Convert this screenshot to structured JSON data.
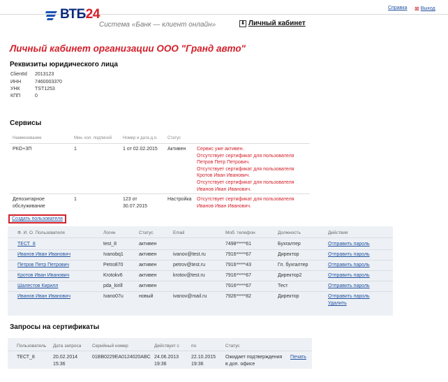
{
  "header": {
    "logo_text_main": "ВТБ",
    "logo_text_accent": "24",
    "tagline": "Система «Банк — клиент онлайн»",
    "cabinet_link": "Личный кабинет",
    "help_link": "Справка",
    "exit_link": "Выход"
  },
  "page_title": "Личный кабинет организации ООО \"Гранд авто\"",
  "requisites": {
    "title": "Реквизиты юридического лица",
    "rows": [
      {
        "key": "ClientId",
        "value": "2013123"
      },
      {
        "key": "ИНН",
        "value": "7460003370"
      },
      {
        "key": "УНК",
        "value": "TST1253"
      },
      {
        "key": "КПП",
        "value": "0"
      }
    ]
  },
  "services": {
    "title": "Сервисы",
    "headers": [
      "Наименование",
      "Мин. кол. подписей",
      "Номер и дата д.о.",
      "Статус"
    ],
    "rows": [
      {
        "name": "РКО+ЗП",
        "min": "1",
        "number_date": "1 от 02.02.2015",
        "status": "Активен",
        "messages": [
          "Сервис уже активен.",
          "Отсутствует сертификат для пользователя",
          "Петров Петр Петрович.",
          "Отсутствует сертификат для пользователя",
          "Кротов Иван Иванович.",
          "Отсутствует сертификат для пользователя",
          "Иванов Иван Иванович."
        ]
      },
      {
        "name_line1": "Депозитарное",
        "name_line2": "обслуживание",
        "min": "1",
        "number_line1": "123 от",
        "number_line2": "30.07.2015",
        "status": "Настройка",
        "messages": [
          "Отсутствует сертификат для пользователя",
          "Иванов Иван Иванович."
        ]
      }
    ]
  },
  "create_user_link": "Создать пользователя",
  "users": {
    "headers": [
      "Ф. И. О. Пользователя",
      "Логин",
      "Статус",
      "Email",
      "Моб. телефон",
      "Должность",
      "Действия"
    ],
    "rows": [
      {
        "name": "ТЕСТ_8",
        "login": "test_8",
        "status": "активен",
        "email": "",
        "phone": "7498*****61",
        "position": "Бухгалтер",
        "action": "Отправить пароль",
        "action2": ""
      },
      {
        "name": "Иванов Иван Иванович",
        "login": "Ivanobq1",
        "status": "активен",
        "email": "ivanov@test.ru",
        "phone": "7916*****67",
        "position": "Директор",
        "action": "Отправить пароль",
        "action2": ""
      },
      {
        "name": "Петров Петр Петрович",
        "login": "Petro870",
        "status": "активен",
        "email": "petrov@test.ru",
        "phone": "7916*****43",
        "position": "Гл. бухгалтер",
        "action": "Отправить пароль",
        "action2": ""
      },
      {
        "name": "Кротов Иван Иванович",
        "login": "Krotokv6",
        "status": "активен",
        "email": "krotov@test.ru",
        "phone": "7916*****67",
        "position": "Директор2",
        "action": "Отправить пароль",
        "action2": ""
      },
      {
        "name": "Шалестов Кирилл",
        "login": "pda_kirill",
        "status": "активен",
        "email": "",
        "phone": "7916*****67",
        "position": "Тест",
        "action": "Отправить пароль",
        "action2": ""
      },
      {
        "name": "Иванов Иван Иванович",
        "login": "Ivano07u",
        "status": "новый",
        "email": "ivanov@mail.ru",
        "phone": "7926*****82",
        "position": "Директор",
        "action": "Отправить пароль",
        "action2": "Удалить"
      }
    ]
  },
  "cert_requests": {
    "title": "Запросы на сертификаты",
    "headers": [
      "Пользователь",
      "Дата запроса",
      "Серийный номер",
      "Действует с",
      "по",
      "Статус"
    ],
    "rows": [
      {
        "user": "ТЕСТ_8",
        "date1": "20.02.2014",
        "time1": "15:36",
        "serial": "01BB0229EA0124020ABC",
        "from1": "24.06.2013",
        "from2": "19:36",
        "to1": "22.10.2015",
        "to2": "19:36",
        "status1": "Ожидает подтверждения",
        "status2": "в доп. офисе",
        "action": "Печать"
      }
    ]
  },
  "colors": {
    "accent_red": "#d3202b",
    "brand_blue": "#0a2a7a",
    "link_blue": "#1f4f9f",
    "table_bg": "#edf1f5"
  }
}
